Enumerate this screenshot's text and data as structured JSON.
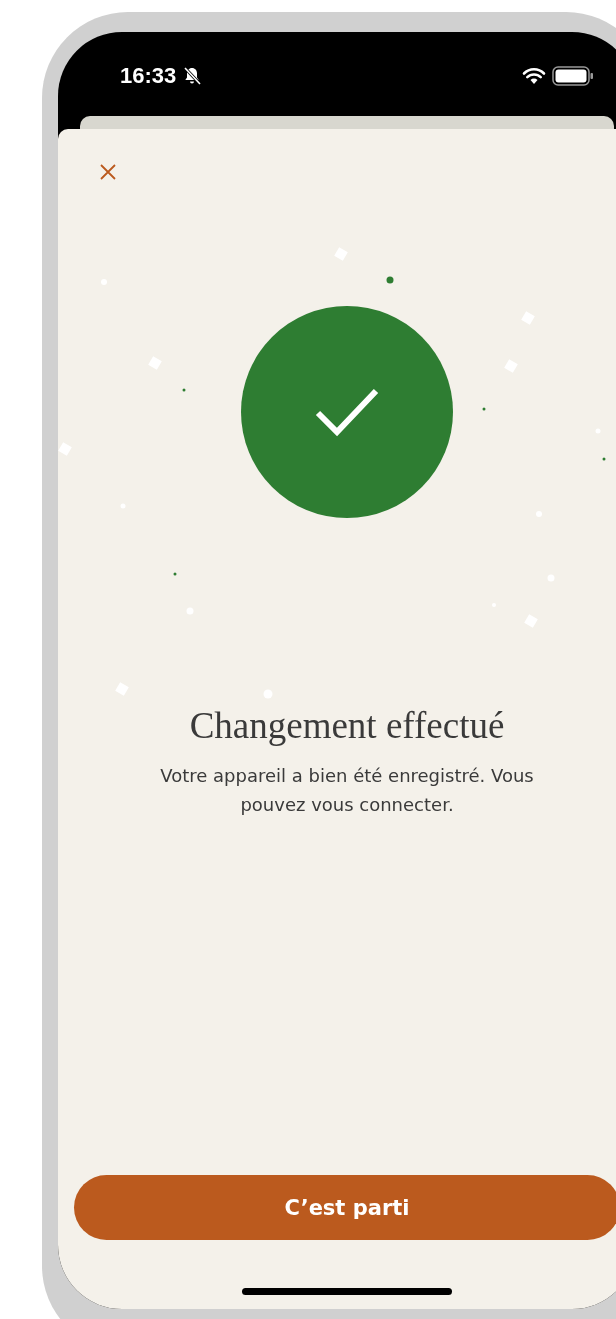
{
  "status_bar": {
    "time": "16:33"
  },
  "title": "Changement effectué",
  "message": "Votre appareil a bien été enregistré. Vous pouvez vous connecter.",
  "button": {
    "label": "C’est parti"
  }
}
